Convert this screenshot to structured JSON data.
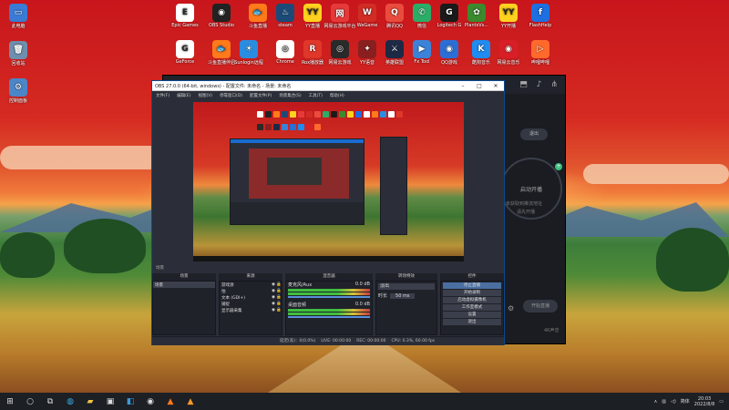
{
  "desktop": {
    "icons": [
      {
        "label": "此电脑",
        "glyph": "▭",
        "color": "#3a7bd5"
      },
      {
        "label": "回收站",
        "glyph": "🗑",
        "color": "#6f8fae"
      },
      {
        "label": "控制面板",
        "glyph": "⚙",
        "color": "#4b86c9"
      },
      {
        "label": "Epic Games",
        "glyph": "E",
        "color": "#fff"
      },
      {
        "label": "OBS Studio",
        "glyph": "◉",
        "color": "#222"
      },
      {
        "label": "斗鱼直播",
        "glyph": "🐟",
        "color": "#ff7a1a"
      },
      {
        "label": "steam",
        "glyph": "♨",
        "color": "#1b4a78"
      },
      {
        "label": "YY直播",
        "glyph": "YY",
        "color": "#ffd21f"
      },
      {
        "label": "网易云游戏平台",
        "glyph": "网",
        "color": "#e63a3a"
      },
      {
        "label": "WeGame",
        "glyph": "W",
        "color": "#d12d24"
      },
      {
        "label": "腾讯QQ",
        "glyph": "Q",
        "color": "#e94c3d"
      },
      {
        "label": "微信",
        "glyph": "✆",
        "color": "#2aae67"
      },
      {
        "label": "Logitech G",
        "glyph": "G",
        "color": "#1a1a1a"
      },
      {
        "label": "PlantsVs...",
        "glyph": "✿",
        "color": "#3b8a2e"
      },
      {
        "label": "YY开播",
        "glyph": "YY",
        "color": "#ffd21f"
      },
      {
        "label": "FlashHelp",
        "glyph": "f",
        "color": "#1e6fe0"
      },
      {
        "label": "GeForce",
        "glyph": "G",
        "color": "#fff"
      },
      {
        "label": "斗鱼直播伴侣",
        "glyph": "🐟",
        "color": "#ff7a1a"
      },
      {
        "label": "Sunlogin远程",
        "glyph": "☀",
        "color": "#2a8de0"
      },
      {
        "label": "Chrome",
        "glyph": "◎",
        "color": "#fff"
      },
      {
        "label": "Rox播放器",
        "glyph": "R",
        "color": "#e0372b"
      },
      {
        "label": "网易云游戏",
        "glyph": "◎",
        "color": "#2a2a2a"
      },
      {
        "label": "YY语音",
        "glyph": "✦",
        "color": "#8a1f1f"
      },
      {
        "label": "英雄联盟",
        "glyph": "⚔",
        "color": "#1d2a45"
      },
      {
        "label": "Fx Tool",
        "glyph": "▶",
        "color": "#3b83d8"
      },
      {
        "label": "QQ游戏",
        "glyph": "◉",
        "color": "#2b6fd6"
      },
      {
        "label": "酷狗音乐",
        "glyph": "K",
        "color": "#1e8cf0"
      },
      {
        "label": "网易云音乐",
        "glyph": "◉",
        "color": "#d81e26"
      },
      {
        "label": "哔哩哔哩",
        "glyph": "▷",
        "color": "#ff6a2c"
      }
    ]
  },
  "kuaishou": {
    "stop": "退出",
    "circle": "启动开播",
    "hint1": "未获取到推流地址",
    "hint2": "请先开播",
    "btn": "开始直播",
    "bottom": "4K声音"
  },
  "obs": {
    "title": "OBS 27.0.0 (64-bit, windows) - 配置文件: 未命名 - 场景: 未命名",
    "menu": [
      "文件(F)",
      "编辑(E)",
      "视图(V)",
      "停靠窗口(D)",
      "配置文件(P)",
      "场景集合(S)",
      "工具(T)",
      "帮助(H)"
    ],
    "scenes_header": "场景",
    "scene": "场景",
    "sources_header": "来源",
    "sources": [
      "游戏源",
      "怕",
      "文本 (GDI+)",
      "捕捉",
      "显示器采集"
    ],
    "mixer_header": "混音器",
    "mixer": [
      {
        "name": "麦克风/Aux",
        "db": "0.0 dB"
      },
      {
        "name": "桌面音频",
        "db": "0.0 dB"
      }
    ],
    "transition_header": "转场特效",
    "transition": "淡出",
    "duration_label": "时长",
    "duration": "50 ms",
    "controls_header": "控件",
    "controls": [
      "停止直播",
      "开始录制",
      "启动虚拟摄像机",
      "工作室模式",
      "设置",
      "退出"
    ],
    "status": {
      "live": "LIVE: 00:00:00",
      "rec": "REC: 00:00:00",
      "cpu": "CPU: 0.3%, 60.00 fps",
      "dropped": "延迟(丢)：0(0.0%)",
      "delay": "延迟 (1 秒后开始)"
    }
  },
  "taskbar": {
    "ime": "简体",
    "time": "20:03",
    "date": "2022/8/8"
  }
}
